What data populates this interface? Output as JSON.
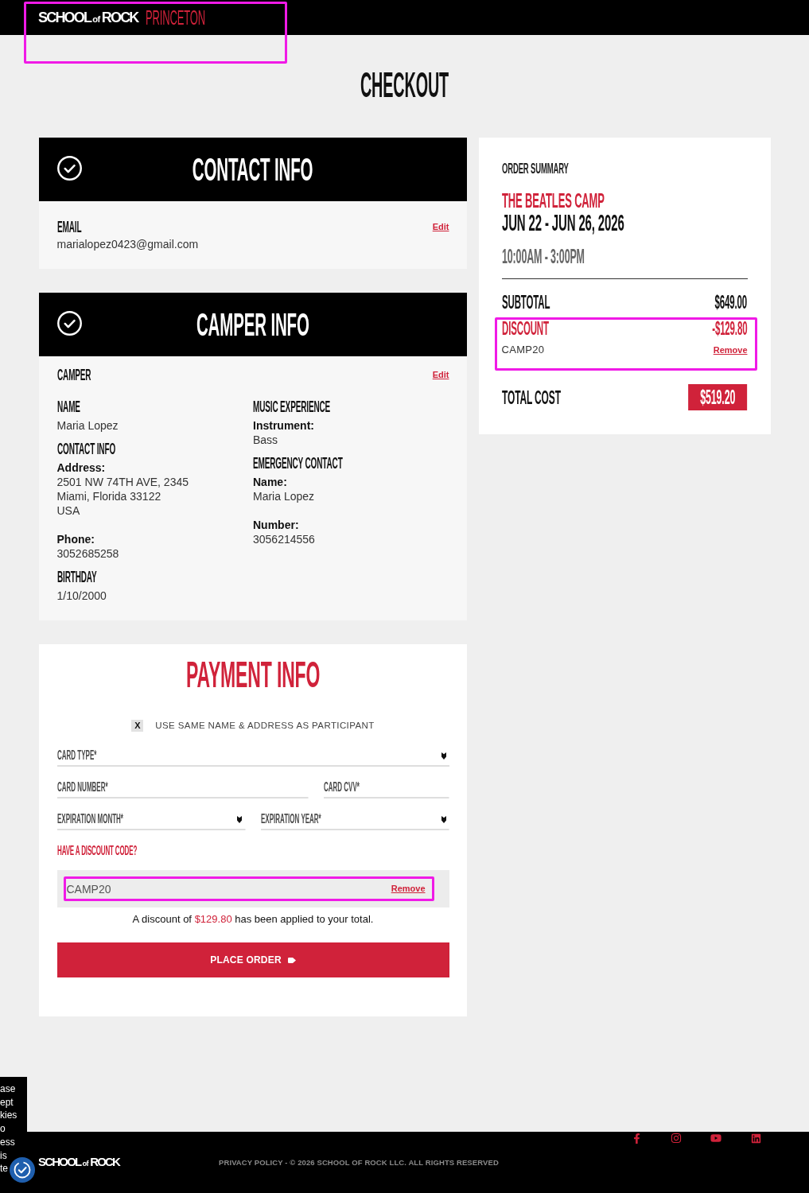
{
  "header": {
    "logo": [
      "SCHOOL",
      "of",
      "ROCK"
    ],
    "location": "PRINCETON",
    "highlighted": true
  },
  "page_title": "CHECKOUT",
  "sections": [
    {
      "kind": "simple",
      "title": "CONTACT INFO",
      "completed": true,
      "heading": "EMAIL",
      "edit": "Edit",
      "value": "marialopez0423@gmail.com"
    },
    {
      "kind": "columns",
      "title": "CAMPER INFO",
      "completed": true,
      "heading": "CAMPER",
      "edit": "Edit",
      "columns": [
        [
          {
            "heading": "NAME",
            "items": [
              {
                "lines": [
                  "Maria Lopez"
                ]
              }
            ]
          },
          {
            "heading": "CONTACT INFO",
            "items": [
              {
                "label": "Address:",
                "lines": [
                  "2501 NW 74TH AVE, 2345",
                  "Miami, Florida 33122",
                  "USA"
                ]
              },
              {
                "label": "Phone:",
                "lines": [
                  "3052685258"
                ]
              }
            ]
          },
          {
            "heading": "BIRTHDAY",
            "items": [
              {
                "lines": [
                  "1/10/2000"
                ]
              }
            ]
          }
        ],
        [
          {
            "heading": "MUSIC EXPERIENCE",
            "items": [
              {
                "label": "Instrument:",
                "lines": [
                  "Bass"
                ]
              }
            ]
          },
          {
            "heading": "EMERGENCY CONTACT",
            "items": [
              {
                "label": "Name:",
                "lines": [
                  "Maria Lopez"
                ]
              },
              {
                "label": "Number:",
                "lines": [
                  "3056214556"
                ]
              }
            ]
          }
        ]
      ]
    }
  ],
  "order_summary": {
    "title": "ORDER SUMMARY",
    "camp": "THE BEATLES CAMP",
    "dates": "JUN 22 - JUN 26, 2026",
    "time": "10:00AM - 3:00PM",
    "subtotal": {
      "label": "SUBTOTAL",
      "amount": "$649.00"
    },
    "discount": {
      "label": "DISCOUNT",
      "amount": "-$129.80",
      "code": "CAMP20",
      "remove": "Remove",
      "highlighted": true
    },
    "total": {
      "label": "TOTAL COST",
      "amount": "$519.20"
    }
  },
  "payment": {
    "title": "PAYMENT INFO",
    "same_address": {
      "mark": "X",
      "checked": true,
      "label": "USE SAME NAME & ADDRESS AS PARTICIPANT"
    },
    "field_rows": [
      [
        {
          "kind": "select",
          "placeholder": "CARD TYPE*"
        }
      ],
      [
        {
          "kind": "text",
          "placeholder": "CARD NUMBER*"
        },
        {
          "kind": "text",
          "placeholder": "CARD CVV*"
        }
      ],
      [
        {
          "kind": "select",
          "placeholder": "EXPIRATION MONTH*"
        },
        {
          "kind": "select",
          "placeholder": "EXPIRATION YEAR*"
        }
      ]
    ],
    "discount_prompt": "HAVE A DISCOUNT CODE?",
    "discount_field": {
      "value": "CAMP20",
      "remove": "Remove",
      "highlighted": true
    },
    "discount_message": {
      "before": "A discount of",
      "amount": "$129.80",
      "after": "has been applied to your total."
    },
    "place_order": "PLACE ORDER"
  },
  "footer": {
    "logo": [
      "SCHOOL",
      "of",
      "ROCK"
    ],
    "legal_link": "PRIVACY POLICY",
    "legal_text": "- © 2026 SCHOOL OF ROCK LLC. ALL RIGHTS RESERVED"
  },
  "cookie_notice": {
    "lines": [
      "ase",
      "ept",
      "kies",
      "o",
      "ess",
      "is",
      "te"
    ]
  }
}
